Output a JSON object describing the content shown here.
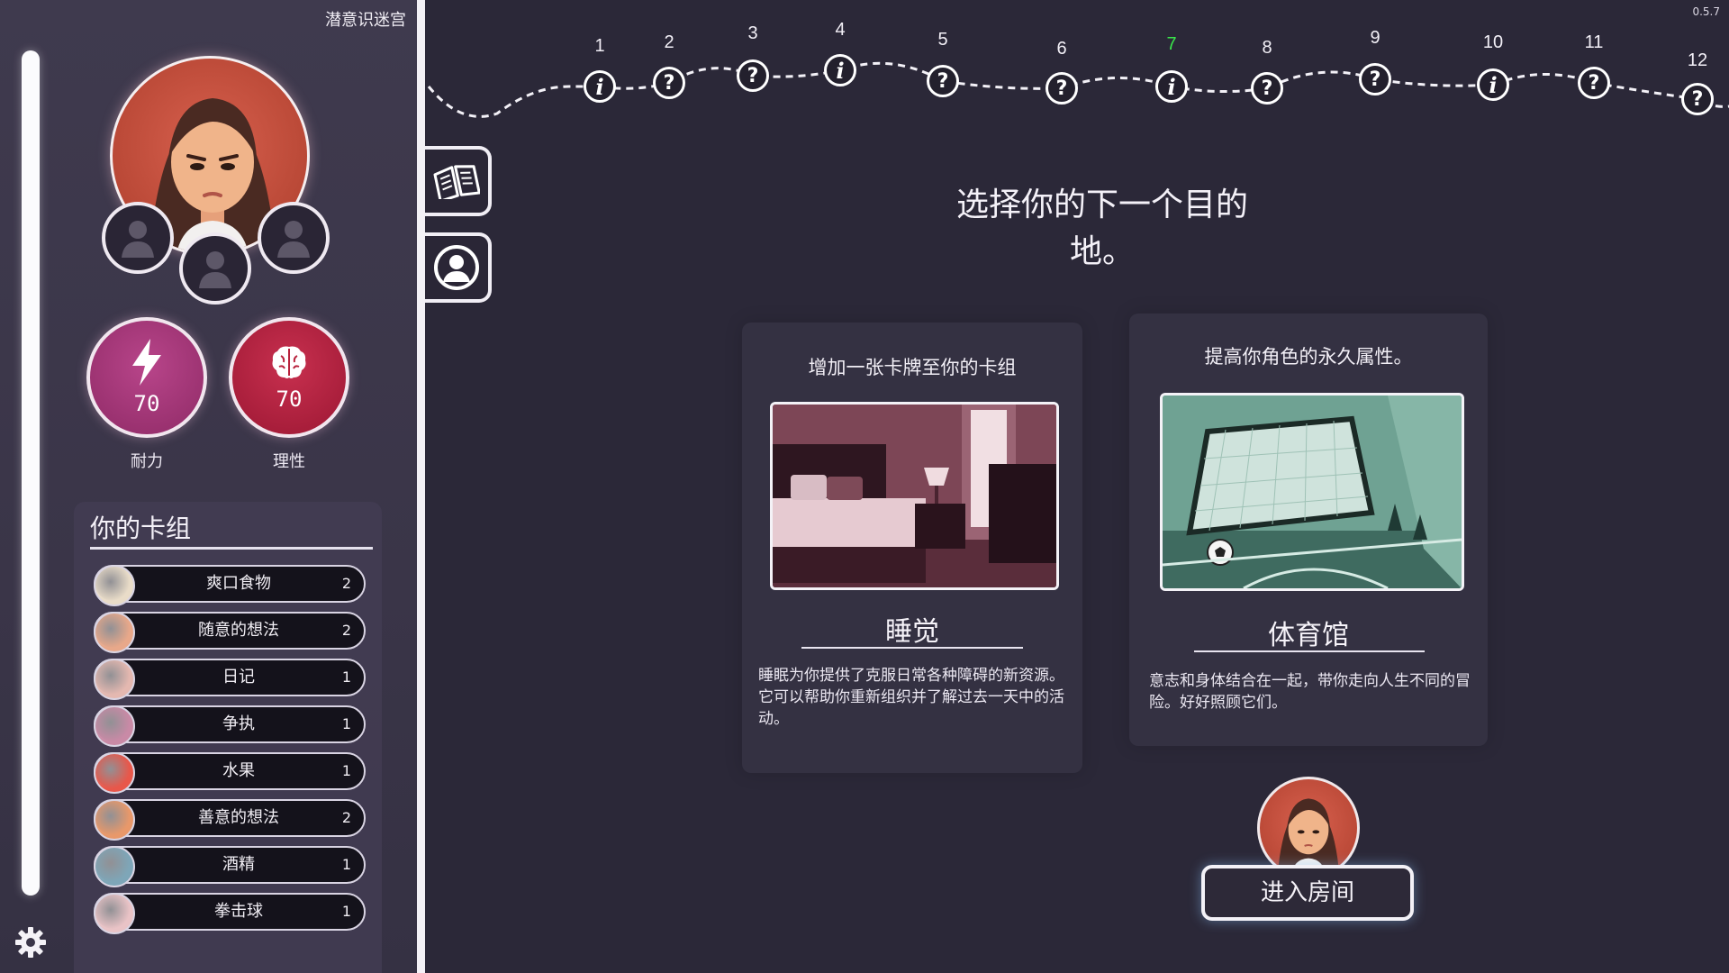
{
  "game_title": "潜意识迷宫",
  "version": "0.5.7",
  "stats": [
    {
      "label": "耐力",
      "value": "70",
      "icon": "lightning-icon",
      "color": "#a5336f"
    },
    {
      "label": "理性",
      "value": "70",
      "icon": "brain-icon",
      "color": "#b8213c"
    }
  ],
  "deck": {
    "title": "你的卡组",
    "cards": [
      {
        "name": "爽口食物",
        "count": "2",
        "icon": "pizza-icon",
        "color": "#e9dcc8"
      },
      {
        "name": "随意的想法",
        "count": "2",
        "icon": "thought-figure-icon",
        "color": "#e8a88a"
      },
      {
        "name": "日记",
        "count": "1",
        "icon": "diary-icon",
        "color": "#e4b8b0"
      },
      {
        "name": "争执",
        "count": "1",
        "icon": "argument-icon",
        "color": "#c98aa6"
      },
      {
        "name": "水果",
        "count": "1",
        "icon": "apple-icon",
        "color": "#e8574a"
      },
      {
        "name": "善意的想法",
        "count": "2",
        "icon": "kind-thought-icon",
        "color": "#e8986a"
      },
      {
        "name": "酒精",
        "count": "1",
        "icon": "alcohol-icon",
        "color": "#7ea6b8"
      },
      {
        "name": "拳击球",
        "count": "1",
        "icon": "boxing-ball-icon",
        "color": "#e9c3c6"
      }
    ]
  },
  "map": {
    "current_node": "7",
    "nodes": [
      {
        "num": "1",
        "type": "info"
      },
      {
        "num": "2",
        "type": "unknown"
      },
      {
        "num": "3",
        "type": "unknown"
      },
      {
        "num": "4",
        "type": "info"
      },
      {
        "num": "5",
        "type": "unknown"
      },
      {
        "num": "6",
        "type": "unknown"
      },
      {
        "num": "7",
        "type": "info"
      },
      {
        "num": "8",
        "type": "unknown"
      },
      {
        "num": "9",
        "type": "unknown"
      },
      {
        "num": "10",
        "type": "info"
      },
      {
        "num": "11",
        "type": "unknown"
      },
      {
        "num": "12",
        "type": "unknown"
      }
    ]
  },
  "prompt": "选择你的下一个目的地。",
  "options": [
    {
      "heading": "增加一张卡牌至你的卡组",
      "name": "睡觉",
      "description": "睡眠为你提供了克服日常各种障碍的新资源。它可以帮助你重新组织并了解过去一天中的活动。"
    },
    {
      "heading": "提高你角色的永久属性。",
      "name": "体育馆",
      "description": "意志和身体结合在一起，带你走向人生不同的冒险。好好照顾它们。"
    }
  ],
  "enter_button": "进入房间",
  "side_tabs": [
    "book-icon",
    "profile-icon"
  ]
}
